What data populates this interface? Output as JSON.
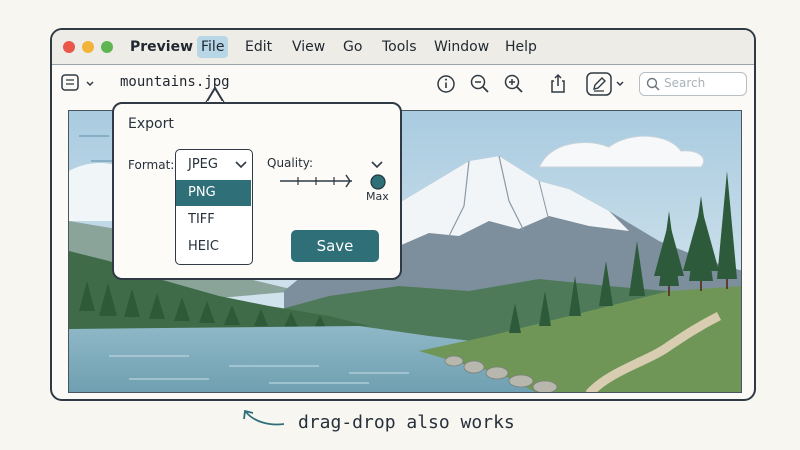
{
  "window": {
    "app_name": "Preview",
    "menus": [
      "File",
      "Edit",
      "View",
      "Go",
      "Tools",
      "Window",
      "Help"
    ],
    "active_menu": "File"
  },
  "toolbar": {
    "filename": "mountains.jpg",
    "search_placeholder": "Search"
  },
  "export_dialog": {
    "title": "Export",
    "format_label": "Format:",
    "formats": [
      "JPEG",
      "PNG",
      "TIFF",
      "HEIC"
    ],
    "selected_format": "PNG",
    "quality_label": "Quality:",
    "quality_value_label": "Max",
    "quality_level": 0.9,
    "save_label": "Save"
  },
  "annotation": {
    "text": "drag-drop also works"
  },
  "colors": {
    "accent": "#2f6f78",
    "menu_highlight": "#b8d7e6"
  }
}
